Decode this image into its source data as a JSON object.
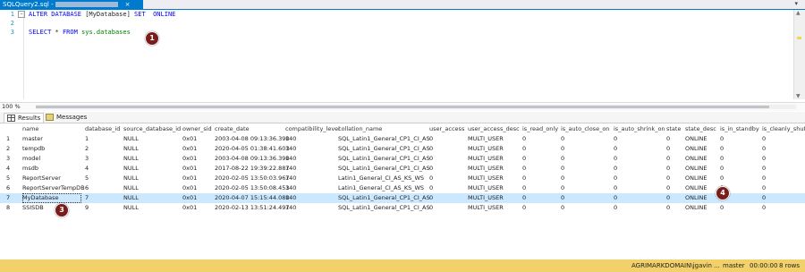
{
  "tab": {
    "title": "SQLQuery2.sql -",
    "close": "×",
    "dropdown": "▾"
  },
  "editor": {
    "lines": [
      {
        "num": "1",
        "collapse": "−",
        "parts": [
          [
            "kw",
            "ALTER DATABASE "
          ],
          [
            "txt",
            "[MyDatabase] "
          ],
          [
            "kw",
            "SET  ONLINE"
          ]
        ]
      },
      {
        "num": "2",
        "collapse": "",
        "parts": []
      },
      {
        "num": "3",
        "collapse": "",
        "parts": [
          [
            "kw",
            "SELECT "
          ],
          [
            "txt",
            "* "
          ],
          [
            "kw",
            "FROM "
          ],
          [
            "obj",
            "sys.databases"
          ]
        ]
      }
    ]
  },
  "zoom": "100 %",
  "results_tabs": {
    "results": "Results",
    "messages": "Messages"
  },
  "grid": {
    "columns": [
      "name",
      "database_id",
      "source_database_id",
      "owner_sid",
      "create_date",
      "compatibility_level",
      "collation_name",
      "user_access",
      "user_access_desc",
      "is_read_only",
      "is_auto_close_on",
      "is_auto_shrink_on",
      "state",
      "state_desc",
      "is_in_standby",
      "is_cleanly_shutd"
    ],
    "rows": [
      [
        "1",
        "master",
        "1",
        "NULL",
        "0x01",
        "2003-04-08 09:13:36.390",
        "140",
        "SQL_Latin1_General_CP1_CI_AS",
        "0",
        "MULTI_USER",
        "0",
        "0",
        "0",
        "0",
        "ONLINE",
        "0",
        "0"
      ],
      [
        "2",
        "tempdb",
        "2",
        "NULL",
        "0x01",
        "2020-04-05 01:38:41.603",
        "140",
        "SQL_Latin1_General_CP1_CI_AS",
        "0",
        "MULTI_USER",
        "0",
        "0",
        "0",
        "0",
        "ONLINE",
        "0",
        "0"
      ],
      [
        "3",
        "model",
        "3",
        "NULL",
        "0x01",
        "2003-04-08 09:13:36.390",
        "140",
        "SQL_Latin1_General_CP1_CI_AS",
        "0",
        "MULTI_USER",
        "0",
        "0",
        "0",
        "0",
        "ONLINE",
        "0",
        "0"
      ],
      [
        "4",
        "msdb",
        "4",
        "NULL",
        "0x01",
        "2017-08-22 19:39:22.887",
        "140",
        "SQL_Latin1_General_CP1_CI_AS",
        "0",
        "MULTI_USER",
        "0",
        "0",
        "0",
        "0",
        "ONLINE",
        "0",
        "0"
      ],
      [
        "5",
        "ReportServer",
        "5",
        "NULL",
        "0x01",
        "2020-02-05 13:50:03.967",
        "140",
        "Latin1_General_CI_AS_KS_WS",
        "0",
        "MULTI_USER",
        "0",
        "0",
        "0",
        "0",
        "ONLINE",
        "0",
        "0"
      ],
      [
        "6",
        "ReportServerTempDB",
        "6",
        "NULL",
        "0x01",
        "2020-02-05 13:50:08.453",
        "140",
        "Latin1_General_CI_AS_KS_WS",
        "0",
        "MULTI_USER",
        "0",
        "0",
        "0",
        "0",
        "ONLINE",
        "0",
        "0"
      ],
      [
        "7",
        "MyDatabase",
        "7",
        "NULL",
        "0x01",
        "2020-04-07 15:15:44.080",
        "140",
        "SQL_Latin1_General_CP1_CI_AS",
        "0",
        "MULTI_USER",
        "0",
        "0",
        "0",
        "0",
        "ONLINE",
        "0",
        "0"
      ],
      [
        "8",
        "SSISDB",
        "9",
        "NULL",
        "0x01",
        "2020-02-13 13:51:24.497",
        "140",
        "SQL_Latin1_General_CP1_CI_AS",
        "0",
        "MULTI_USER",
        "0",
        "0",
        "0",
        "0",
        "ONLINE",
        "0",
        "0"
      ]
    ]
  },
  "callouts": [
    "1",
    "3",
    "4"
  ],
  "status": {
    "server": "AGRIMARKDOMAIN\\jgavin ...",
    "database": "master",
    "time": "00:00:00",
    "rows": "8 rows"
  },
  "colors": {
    "accent": "#007acc",
    "selected_row": "#cce8ff",
    "status_bar": "#f2d16b",
    "callout": "#7a1c1c"
  }
}
